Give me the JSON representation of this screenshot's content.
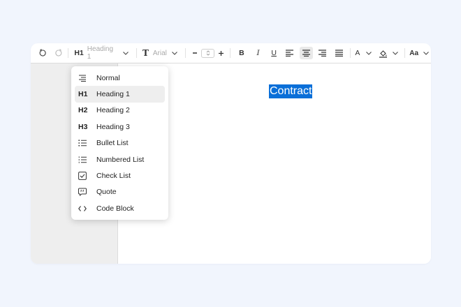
{
  "toolbar": {
    "block_type_prefix": "H1",
    "block_type_label": "Heading 1",
    "font_glyph": "T",
    "font_family": "Arial",
    "bold": "B",
    "italic": "I",
    "underline": "U",
    "text_color_glyph": "A",
    "case_label": "Aa",
    "icons": [
      "undo-icon",
      "redo-icon",
      "chevron-down-icon",
      "minus-icon",
      "plus-icon",
      "align-left-icon",
      "align-center-icon",
      "align-right-icon",
      "align-justify-icon",
      "highlight-icon"
    ]
  },
  "document": {
    "title": "Contract"
  },
  "block_menu": {
    "items": [
      {
        "icon_text": "",
        "icon": "paragraph-icon",
        "label": "Normal"
      },
      {
        "icon_text": "H1",
        "icon": "h1-icon",
        "label": "Heading 1",
        "active": true
      },
      {
        "icon_text": "H2",
        "icon": "h2-icon",
        "label": "Heading 2"
      },
      {
        "icon_text": "H3",
        "icon": "h3-icon",
        "label": "Heading 3"
      },
      {
        "icon_text": "",
        "icon": "bullet-list-icon",
        "label": "Bullet List"
      },
      {
        "icon_text": "",
        "icon": "numbered-list-icon",
        "label": "Numbered List"
      },
      {
        "icon_text": "",
        "icon": "checkbox-icon",
        "label": "Check List"
      },
      {
        "icon_text": "",
        "icon": "quote-icon",
        "label": "Quote"
      },
      {
        "icon_text": "",
        "icon": "code-icon",
        "label": "Code Block"
      }
    ]
  },
  "colors": {
    "page_bg": "#f1f5fd",
    "selection": "#0a6fd8",
    "sidebar": "#eeeeee",
    "active_item": "#eeeeee"
  }
}
